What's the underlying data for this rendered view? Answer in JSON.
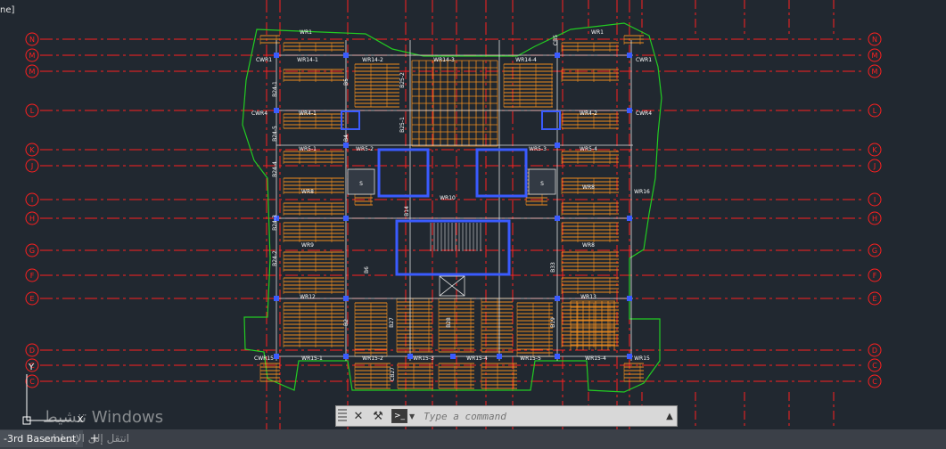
{
  "window": {
    "corner_label": "ne]"
  },
  "grid_labels": {
    "rows": [
      "N",
      "M",
      "M",
      "L",
      "K",
      "J",
      "I",
      "H",
      "G",
      "F",
      "E",
      "D",
      "C",
      "C"
    ]
  },
  "plan_labels": {
    "top": [
      "WR1",
      "WR1",
      "CWR1",
      "WR14-1",
      "WR14-2",
      "WR14-3",
      "WR14-4",
      "CWR1"
    ],
    "mid": [
      "CWR4",
      "WR4-1",
      "WR4-2",
      "CWR4",
      "WR5-1",
      "WR5-2",
      "WR5-3",
      "WR5-4",
      "WR8",
      "WR9",
      "WR16",
      "WR8",
      "WR8",
      "WR13",
      "WR12",
      "WR10"
    ],
    "bottom": [
      "CWR15",
      "WR15-1",
      "WR15-2",
      "WR15-3",
      "WR15-4",
      "WR15-5",
      "WR15-4",
      "WR15"
    ],
    "beams": [
      "B25-1",
      "B25-2",
      "B24-1",
      "B24-2",
      "B24-3",
      "B24-4",
      "B24-5",
      "B33",
      "B14",
      "B6",
      "B27",
      "B28",
      "B19",
      "B2",
      "CB27",
      "CB5",
      "B4",
      "B5"
    ],
    "shaft": "S"
  },
  "command_line": {
    "close_symbol": "✕",
    "wrench_symbol": "⚒",
    "prompt_symbol": ">_",
    "placeholder": "Type a command",
    "arrow_symbol": "▲"
  },
  "layout_tabs": {
    "active": "-3rd Basement",
    "add_symbol": "+"
  },
  "watermark": {
    "line1": "تنشيط Windows",
    "line2": "انتقل إلى الإعدادات"
  },
  "ucs": {
    "y_label": "Y",
    "x_label": "X"
  },
  "colors": {
    "background": "#212830",
    "axis_red": "#ff2020",
    "slab_orange": "#f08c1e",
    "outline_green": "#22cc22",
    "column_blue": "#3a5bff",
    "text_white": "#ffffff"
  }
}
